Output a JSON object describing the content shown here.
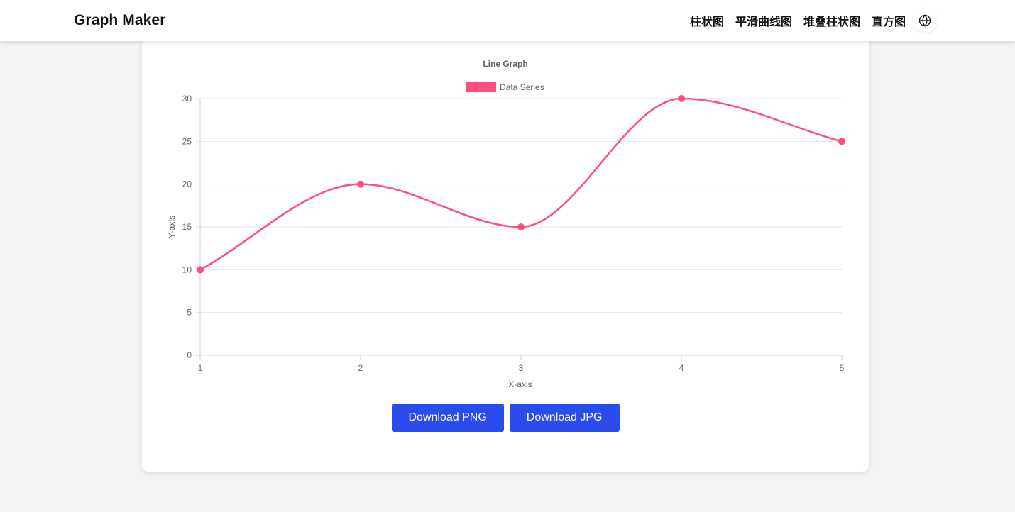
{
  "header": {
    "brand": "Graph Maker",
    "nav": [
      "柱状图",
      "平滑曲线图",
      "堆叠柱状图",
      "直方图"
    ],
    "language_icon": "globe-icon"
  },
  "chart_data": {
    "type": "line",
    "title": "Line Graph",
    "xlabel": "X-axis",
    "ylabel": "Y-axis",
    "x": [
      1,
      2,
      3,
      4,
      5
    ],
    "series": [
      {
        "name": "Data Series",
        "values": [
          10,
          20,
          15,
          30,
          25
        ],
        "color": "#ff4d7d"
      }
    ],
    "ylim": [
      0,
      30
    ],
    "yticks": [
      0,
      5,
      10,
      15,
      20,
      25,
      30
    ],
    "smooth": true,
    "legend": "top-center",
    "grid": true
  },
  "actions": {
    "download_png": "Download PNG",
    "download_jpg": "Download JPG"
  },
  "colors": {
    "accent": "#2b4ced",
    "series": "#ff4d7d",
    "background": "#f2f3f5"
  }
}
